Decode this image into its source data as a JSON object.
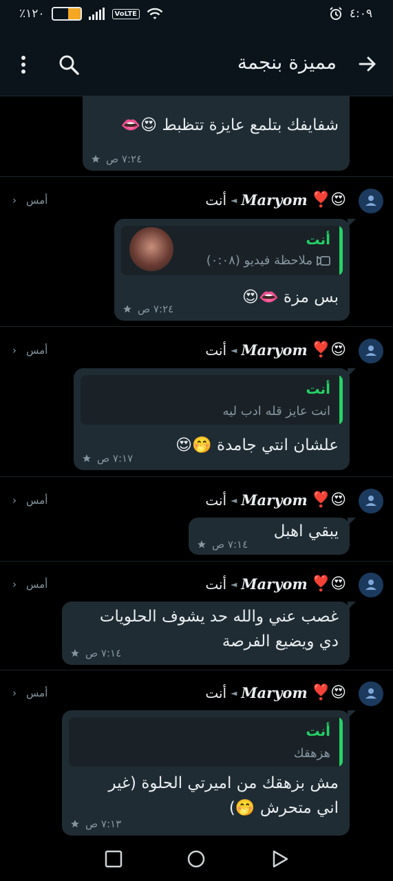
{
  "status": {
    "battery_text": "٪١٢٠",
    "battery_level": 0.45,
    "volte": "VoLTE",
    "time": "٤:٠٩"
  },
  "header": {
    "title": "مميزة بنجمة",
    "back_icon": "arrow-right-icon",
    "search_icon": "search-icon",
    "menu_icon": "more-vert-icon"
  },
  "messages": [
    {
      "text": "شفايفك بتلمع عايزة تتظبط 😍👄",
      "time": "٧:٢٤ ص",
      "starred": true
    },
    {
      "sender": "Maryom",
      "sender_emoji": "❣️😍",
      "recipient": "أنت",
      "ago": "أمس",
      "quote_author": "أنت",
      "quote_text": "ملاحظة فيديو  (٠:٠٨)",
      "text": "بس مزة 👄😍",
      "time": "٧:٢٤ ص",
      "starred": true
    },
    {
      "sender": "Maryom",
      "sender_emoji": "❣️😍",
      "recipient": "أنت",
      "ago": "أمس",
      "quote_author": "أنت",
      "quote_text": "انت عايز قله ادب ليه",
      "text": "علشان انتي جامدة 🤭😍",
      "time": "٧:١٧ ص",
      "starred": true
    },
    {
      "sender": "Maryom",
      "sender_emoji": "❣️😍",
      "recipient": "أنت",
      "ago": "أمس",
      "text": "يبقي اهبل",
      "time": "٧:١٤ ص",
      "starred": true
    },
    {
      "sender": "Maryom",
      "sender_emoji": "❣️😍",
      "recipient": "أنت",
      "ago": "أمس",
      "text_line1": "غصب عني والله حد يشوف الحلويات",
      "text_line2": "دي ويضيع الفرصة",
      "time": "٧:١٤ ص",
      "starred": true
    },
    {
      "sender": "Maryom",
      "sender_emoji": "❣️😍",
      "recipient": "أنت",
      "ago": "أمس",
      "quote_author": "أنت",
      "quote_text": "هزهقك",
      "text_line1": "مش بزهقك من اميرتي الحلوة (غير",
      "text_line2": "اني متحرش 🤭)",
      "time": "٧:١٣ ص",
      "starred": true
    }
  ],
  "colors": {
    "bubble": "#1f2c34",
    "accent_green": "#25d366",
    "meta_gray": "#8696a0",
    "avatar_blue": "#1b3a5e"
  }
}
